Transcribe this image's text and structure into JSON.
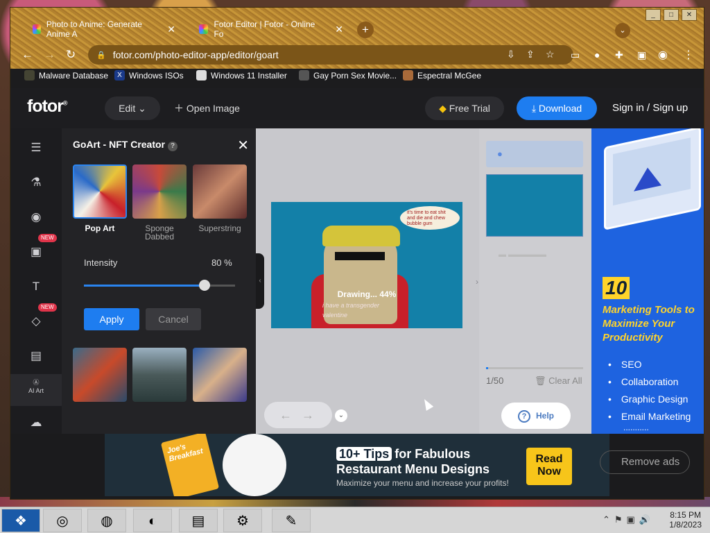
{
  "browser": {
    "tabs": [
      {
        "title": "Photo to Anime: Generate Anime A"
      },
      {
        "title": "Fotor Editor | Fotor - Online Fo"
      }
    ],
    "url": "fotor.com/photo-editor-app/editor/goart",
    "bookmarks": [
      "Malware Database",
      "Windows ISOs",
      "Windows 11 Installer",
      "Gay Porn Sex Movie...",
      "Espectral McGee"
    ]
  },
  "app": {
    "logo": "fotor",
    "edit_label": "Edit",
    "open_image_label": "Open Image",
    "free_trial_label": "Free Trial",
    "download_label": "Download",
    "signin_label": "Sign in / Sign up"
  },
  "rail": {
    "new_badge": "NEW",
    "ai_art_label": "AI Art"
  },
  "panel": {
    "title": "GoArt - NFT Creator",
    "styles": [
      {
        "label": "Pop Art"
      },
      {
        "label": "Sponge Dabbed"
      },
      {
        "label": "Superstring"
      }
    ],
    "intensity_label": "Intensity",
    "intensity_value": "80 %",
    "intensity_fraction": 0.8,
    "apply_label": "Apply",
    "cancel_label": "Cancel"
  },
  "canvas": {
    "drawing_text": "Drawing... 44%",
    "bubble_text": "it's time to eat shit and die and chew bubble gum",
    "caption_line1": "i have a transgender",
    "caption_line2": "valentine"
  },
  "side": {
    "counter": "1/50",
    "clear_all_label": "Clear All",
    "progress_fraction": 0.02,
    "help_label": "Help"
  },
  "ad": {
    "number": "10",
    "title": "Marketing Tools to Maximize Your Productivity",
    "items": [
      "SEO",
      "Collaboration",
      "Graphic Design",
      "Email Marketing"
    ],
    "more": "..........."
  },
  "banner": {
    "tag": "10+ Tips",
    "title_rest": "for Fabulous",
    "title_line2": "Restaurant Menu Designs",
    "subtitle": "Maximize your menu and increase your profits!",
    "menu_text": "Joe's Breakfast",
    "read_now": "Read Now",
    "remove_ads": "Remove ads"
  },
  "taskbar": {
    "time": "8:15 PM",
    "date": "1/8/2023"
  }
}
